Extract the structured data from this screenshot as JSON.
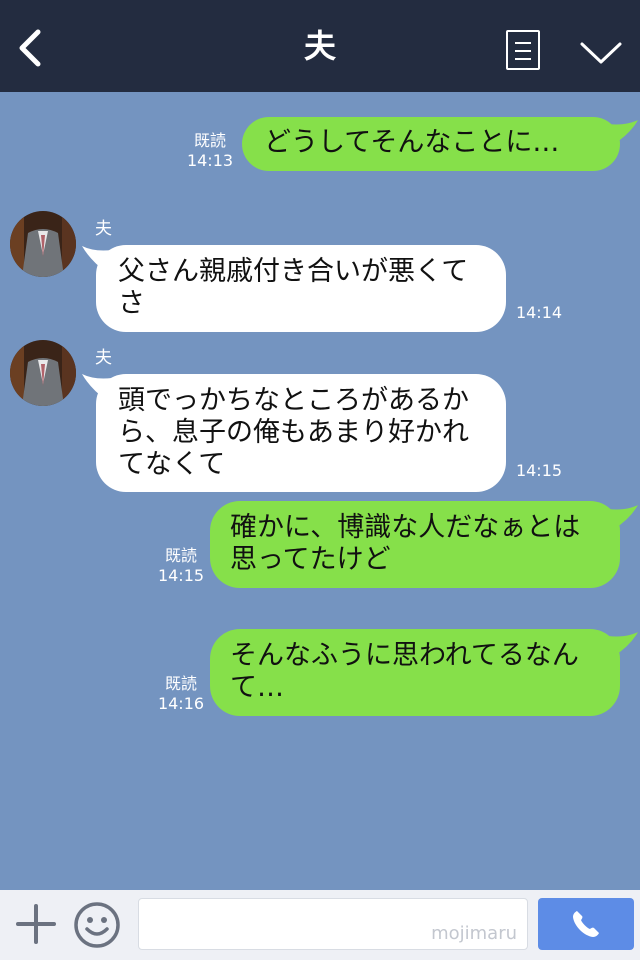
{
  "header": {
    "title": "夫"
  },
  "messages": [
    {
      "side": "right",
      "text": "どうしてそんなことに…",
      "read": "既読",
      "time": "14:13"
    },
    {
      "side": "left",
      "sender": "夫",
      "text": "父さん親戚付き合いが悪くてさ",
      "time": "14:14"
    },
    {
      "side": "left",
      "sender": "夫",
      "text": "頭でっかちなところがあるから、息子の俺もあまり好かれてなくて",
      "time": "14:15"
    },
    {
      "side": "right",
      "text": "確かに、博識な人だなぁとは思ってたけど",
      "read": "既読",
      "time": "14:15"
    },
    {
      "side": "right",
      "text": "そんなふうに思われてるなんて…",
      "read": "既読",
      "time": "14:16"
    }
  ],
  "footer": {
    "watermark": "mojimaru"
  },
  "colors": {
    "header": "#232c40",
    "background": "#7494c0",
    "green_bubble": "#86e04a",
    "call_button": "#5d8ce6"
  },
  "icons": [
    "back-arrow-icon",
    "menu-icon",
    "chevron-down-icon",
    "plus-icon",
    "smile-icon",
    "phone-icon"
  ]
}
